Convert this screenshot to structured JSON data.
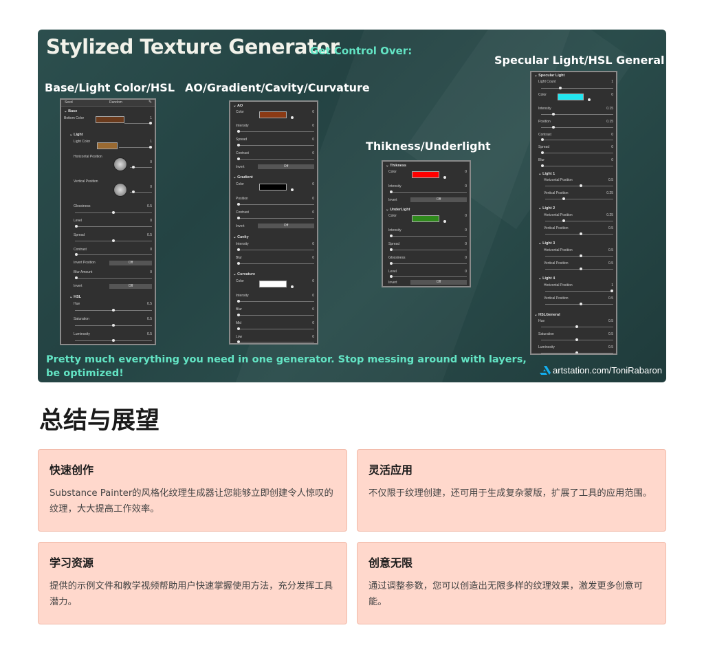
{
  "hero": {
    "title": "Stylized Texture Generator",
    "subtitle": "Get Control Over:",
    "sections": {
      "base": "Base/Light Color/HSL",
      "ao": "AO/Gradient/Cavity/Curvature",
      "thikness": "Thikness/Underlight",
      "specular": "Specular Light/HSL General"
    },
    "tagline": "Pretty much everything you need in one generator. Stop messing around with layers, be optimized!",
    "credit": "artstation.com/ToniRabaron",
    "colors": {
      "accent": "#63e4c4",
      "bg": "#2a4a49"
    }
  },
  "panel_base": {
    "tabs": [
      "Seed",
      "Random"
    ],
    "base_header": "Base",
    "bottom_color": "Bottom Color",
    "bottom_val": "1",
    "light_header": "Light",
    "light_color": "Light Color",
    "light_val": "1",
    "hpos": "Horizontal Position",
    "hpos_val": "0",
    "vpos": "Vertical Position",
    "vpos_val": "0",
    "gloss": "Glossiness",
    "gloss_val": "0.5",
    "level": "Level",
    "level_val": "0",
    "spread": "Spread",
    "spread_val": "0.5",
    "contrast": "Contrast",
    "contrast_val": "0",
    "invpos": "Invert Position",
    "invpos_btn": "Off",
    "blur": "Blur Amount",
    "blur_val": "0",
    "invert": "Invert",
    "invert_btn": "Off",
    "hsl_header": "HSL",
    "hue": "Hue",
    "hue_val": "0.5",
    "sat": "Saturation",
    "sat_val": "0.5",
    "lum": "Luminosity",
    "lum_val": "0.5"
  },
  "panel_ao": {
    "ao_header": "AO",
    "color": "Color",
    "color_val": "0",
    "intensity": "Intensity",
    "intensity_val": "0",
    "spread": "Spread",
    "spread_val": "0",
    "contrast": "Contrast",
    "contrast_val": "0",
    "invert": "Invert",
    "invert_btn": "Off",
    "grad_header": "Gradient",
    "gcolor": "Color",
    "gcolor_val": "0",
    "gpos": "Position",
    "gpos_val": "0",
    "gcontrast": "Contrast",
    "gcontrast_val": "0",
    "ginvert": "Invert",
    "ginvert_btn": "Off",
    "cav_header": "Cavity",
    "cint": "Intensity",
    "cint_val": "0",
    "cblur": "Blur",
    "cblur_val": "0",
    "curv_header": "Curvature",
    "kcolor": "Color",
    "kcolor_val": "0",
    "kint": "Intensity",
    "kint_val": "0",
    "kblur": "Blur",
    "kblur_val": "0",
    "kmid": "Mid",
    "kmid_val": "0",
    "klow": "Low",
    "klow_val": "0"
  },
  "panel_thik": {
    "thik_header": "Thikness",
    "color": "Color",
    "color_val": "0",
    "intensity": "Intensity",
    "intensity_val": "0",
    "invert": "Invert",
    "invert_btn": "Off",
    "under_header": "UnderLight",
    "ucolor": "Color",
    "ucolor_val": "0",
    "uint": "Intensity",
    "uint_val": "0",
    "uspread": "Spread",
    "uspread_val": "0",
    "ugloss": "Glossiness",
    "ugloss_val": "0",
    "ulevel": "Level",
    "ulevel_val": "0",
    "uinvert": "Invert",
    "uinvert_btn": "Off"
  },
  "panel_spec": {
    "spec_header": "Specular Light",
    "count": "Light Count",
    "count_val": "1",
    "color": "Color",
    "color_val": "0",
    "intensity": "Intensity",
    "intensity_val": "0.15",
    "position": "Position",
    "position_val": "0.15",
    "contrast": "Contrast",
    "contrast_val": "0",
    "spread": "Spread",
    "spread_val": "0",
    "blur": "Blur",
    "blur_val": "0",
    "l1": "Light 1",
    "l1h": "Horizontal Position",
    "l1h_val": "0.5",
    "l1v": "Vertical Position",
    "l1v_val": "0.25",
    "l2": "Light 2",
    "l2h": "Horizontal Position",
    "l2h_val": "0.25",
    "l2v": "Vertical Position",
    "l2v_val": "0.5",
    "l3": "Light 3",
    "l3h": "Horizontal Position",
    "l3h_val": "0.5",
    "l3v": "Vertical Position",
    "l3v_val": "0.5",
    "l4": "Light 4",
    "l4h": "Horizontal Position",
    "l4h_val": "1",
    "l4v": "Vertical Position",
    "l4v_val": "0.5",
    "hsl_header": "HSLGeneral",
    "hue": "Hue",
    "hue_val": "0.5",
    "sat": "Saturation",
    "sat_val": "0.5",
    "lum": "Luminosity",
    "lum_val": "0.5"
  },
  "summary": {
    "heading": "总结与展望",
    "cards": [
      {
        "title": "快速创作",
        "body": "Substance Painter的风格化纹理生成器让您能够立即创建令人惊叹的纹理，大大提高工作效率。"
      },
      {
        "title": "灵活应用",
        "body": "不仅限于纹理创建，还可用于生成复杂蒙版，扩展了工具的应用范围。"
      },
      {
        "title": "学习资源",
        "body": "提供的示例文件和教学视频帮助用户快速掌握使用方法，充分发挥工具潜力。"
      },
      {
        "title": "创意无限",
        "body": "通过调整参数，您可以创造出无限多样的纹理效果，激发更多创意可能。"
      }
    ]
  }
}
